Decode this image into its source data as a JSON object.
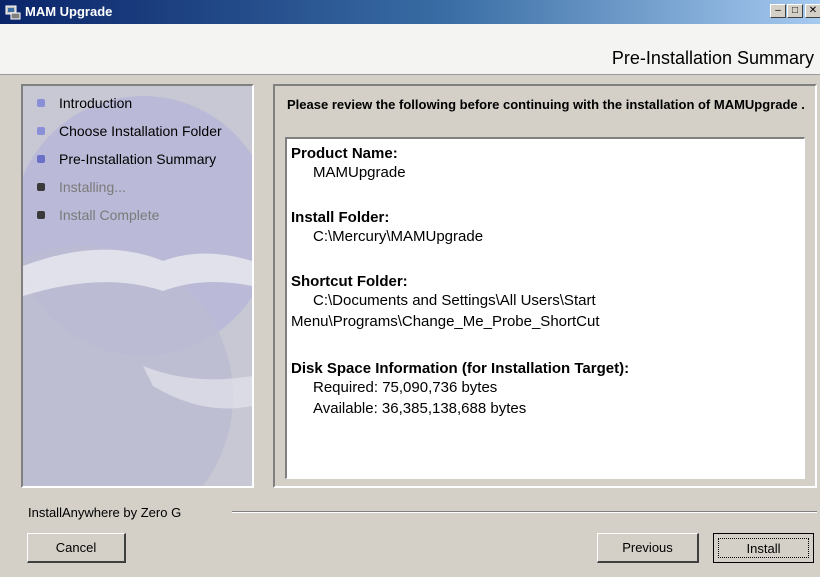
{
  "window": {
    "title": "MAM Upgrade",
    "icon": "installer-app-icon",
    "controls": [
      "minimize-icon",
      "maximize-icon",
      "close-icon"
    ]
  },
  "header": {
    "step_title": "Pre-Installation Summary"
  },
  "steps": [
    {
      "label": "Introduction",
      "state": "done",
      "bullet_color": "#8a8fd8"
    },
    {
      "label": "Choose Installation Folder",
      "state": "done",
      "bullet_color": "#8a8fd8"
    },
    {
      "label": "Pre-Installation Summary",
      "state": "current",
      "bullet_color": "#6a70c8"
    },
    {
      "label": "Installing...",
      "state": "pending",
      "bullet_color": "#3a3a3a"
    },
    {
      "label": "Install Complete",
      "state": "pending",
      "bullet_color": "#3a3a3a"
    }
  ],
  "content": {
    "intro": "Please review the following before continuing with the installation of MAMUpgrade .",
    "sections": [
      {
        "heading": "Product Name:",
        "values": [
          "MAMUpgrade"
        ]
      },
      {
        "heading": "Install Folder:",
        "values": [
          "C:\\Mercury\\MAMUpgrade"
        ]
      },
      {
        "heading": "Shortcut Folder:",
        "values": [
          "C:\\Documents and Settings\\All Users\\Start Menu\\Programs\\Change_Me_Probe_ShortCut"
        ]
      },
      {
        "heading": "Disk Space Information (for Installation Target):",
        "values": [
          "Required: 75,090,736 bytes",
          "Available: 36,385,138,688 bytes"
        ]
      }
    ]
  },
  "footer": {
    "brand": "InstallAnywhere by Zero G",
    "cancel_label": "Cancel",
    "previous_label": "Previous",
    "install_label": "Install"
  }
}
